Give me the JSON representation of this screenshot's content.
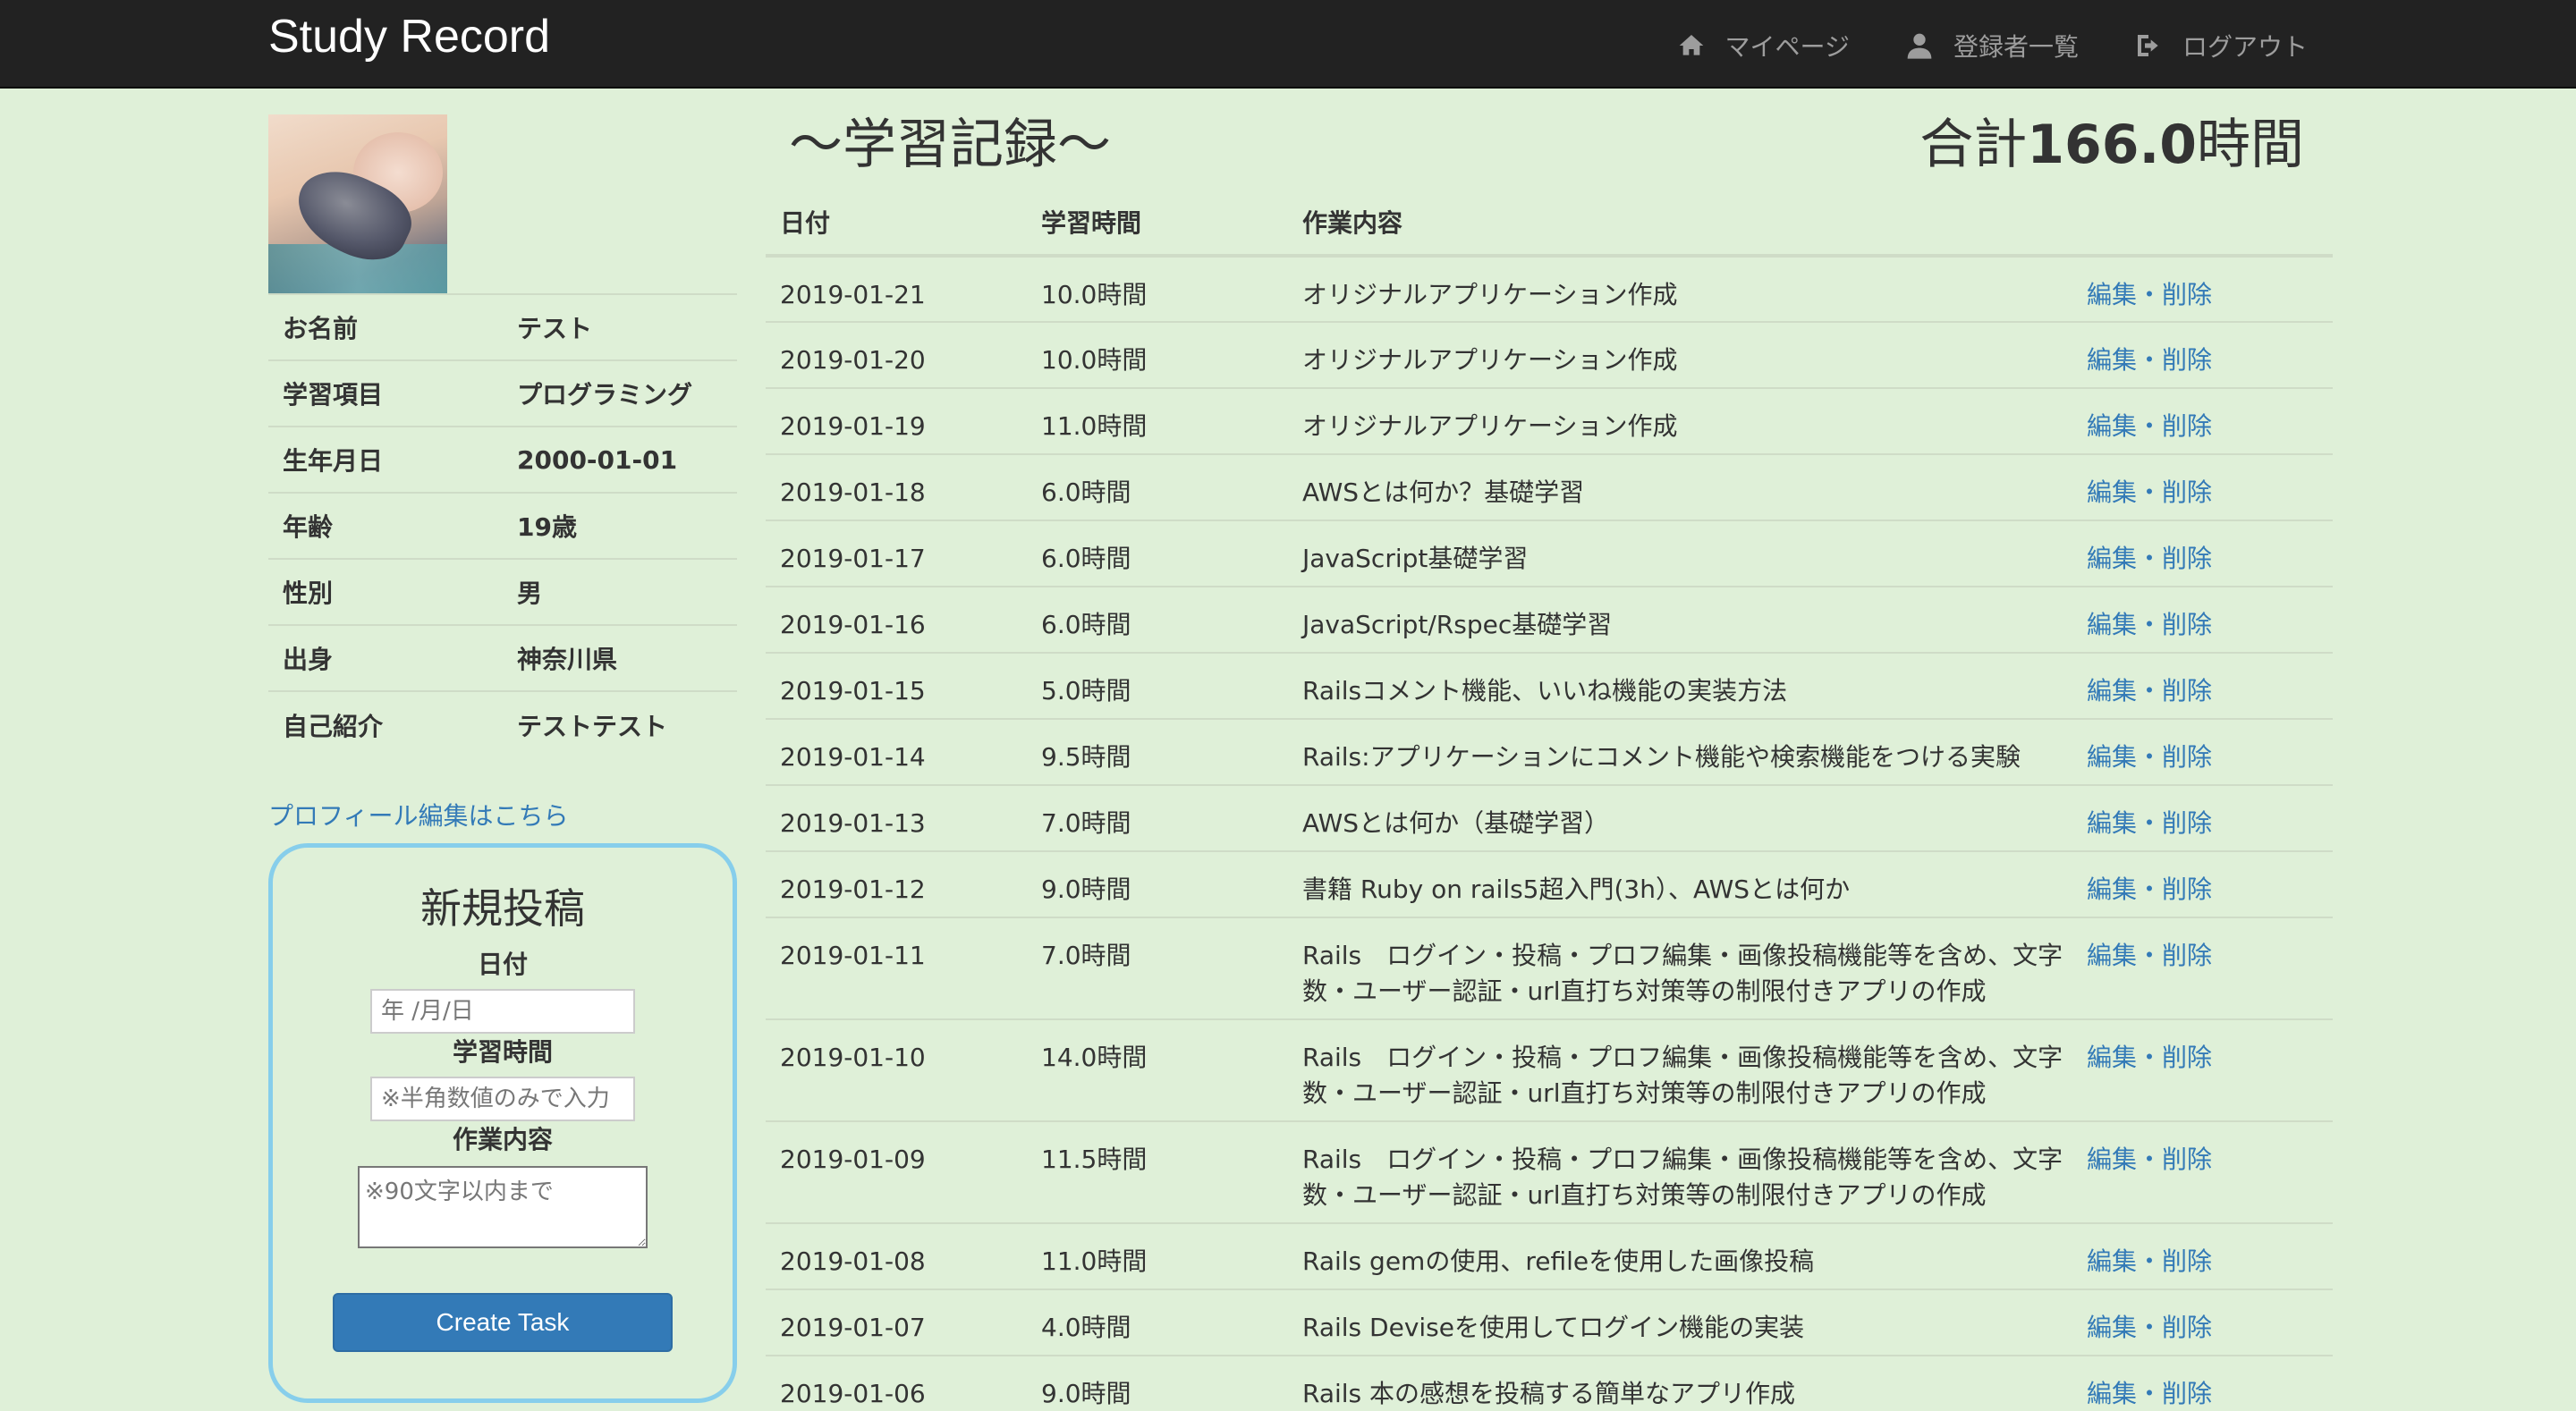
{
  "navbar": {
    "brand": "Study Record",
    "links": [
      {
        "label": "マイページ",
        "icon": "home-icon"
      },
      {
        "label": "登録者一覧",
        "icon": "user-icon"
      },
      {
        "label": "ログアウト",
        "icon": "logout-icon"
      }
    ]
  },
  "profile": {
    "rows": [
      {
        "label": "お名前",
        "value": "テスト"
      },
      {
        "label": "学習項目",
        "value": "プログラミング"
      },
      {
        "label": "生年月日",
        "value": "2000-01-01"
      },
      {
        "label": "年齢",
        "value": "19歳"
      },
      {
        "label": "性別",
        "value": "男"
      },
      {
        "label": "出身",
        "value": "神奈川県"
      },
      {
        "label": "自己紹介",
        "value": "テストテスト"
      }
    ],
    "edit_link": "プロフィール編集はこちら"
  },
  "new_post": {
    "title": "新規投稿",
    "date_label": "日付",
    "date_placeholder": "年 /月/日",
    "time_label": "学習時間",
    "time_placeholder": "※半角数値のみで入力",
    "content_label": "作業内容",
    "content_placeholder": "※90文字以内まで",
    "submit_label": "Create Task"
  },
  "main": {
    "title": "〜学習記録〜",
    "total_prefix": "合計",
    "total_value": "166.0",
    "total_suffix": "時間",
    "columns": [
      "日付",
      "学習時間",
      "作業内容"
    ],
    "edit_label": "編集",
    "sep": "・",
    "delete_label": "削除",
    "records": [
      {
        "date": "2019-01-21",
        "time": "10.0時間",
        "desc": "オリジナルアプリケーション作成"
      },
      {
        "date": "2019-01-20",
        "time": "10.0時間",
        "desc": "オリジナルアプリケーション作成"
      },
      {
        "date": "2019-01-19",
        "time": "11.0時間",
        "desc": "オリジナルアプリケーション作成"
      },
      {
        "date": "2019-01-18",
        "time": "6.0時間",
        "desc": "AWSとは何か？基礎学習"
      },
      {
        "date": "2019-01-17",
        "time": "6.0時間",
        "desc": "JavaScript基礎学習"
      },
      {
        "date": "2019-01-16",
        "time": "6.0時間",
        "desc": "JavaScript/Rspec基礎学習"
      },
      {
        "date": "2019-01-15",
        "time": "5.0時間",
        "desc": "Railsコメント機能、いいね機能の実装方法"
      },
      {
        "date": "2019-01-14",
        "time": "9.5時間",
        "desc": "Rails:アプリケーションにコメント機能や検索機能をつける実験"
      },
      {
        "date": "2019-01-13",
        "time": "7.0時間",
        "desc": "AWSとは何か（基礎学習）"
      },
      {
        "date": "2019-01-12",
        "time": "9.0時間",
        "desc": "書籍 Ruby on rails5超入門(3h）、AWSとは何か"
      },
      {
        "date": "2019-01-11",
        "time": "7.0時間",
        "desc": "Rails　ログイン・投稿・プロフ編集・画像投稿機能等を含め、文字数・ユーザー認証・url直打ち対策等の制限付きアプリの作成",
        "two": true
      },
      {
        "date": "2019-01-10",
        "time": "14.0時間",
        "desc": "Rails　ログイン・投稿・プロフ編集・画像投稿機能等を含め、文字数・ユーザー認証・url直打ち対策等の制限付きアプリの作成",
        "two": true
      },
      {
        "date": "2019-01-09",
        "time": "11.5時間",
        "desc": "Rails　ログイン・投稿・プロフ編集・画像投稿機能等を含め、文字数・ユーザー認証・url直打ち対策等の制限付きアプリの作成",
        "two": true
      },
      {
        "date": "2019-01-08",
        "time": "11.0時間",
        "desc": "Rails gemの使用、refileを使用した画像投稿"
      },
      {
        "date": "2019-01-07",
        "time": "4.0時間",
        "desc": "Rails Deviseを使用してログイン機能の実装"
      },
      {
        "date": "2019-01-06",
        "time": "9.0時間",
        "desc": "Rails 本の感想を投稿する簡単なアプリ作成"
      }
    ]
  },
  "colors": {
    "background": "#dff0d8",
    "navbar": "#222222",
    "link": "#337ab7",
    "button": "#337ab7",
    "form_border": "#87ceeb"
  }
}
